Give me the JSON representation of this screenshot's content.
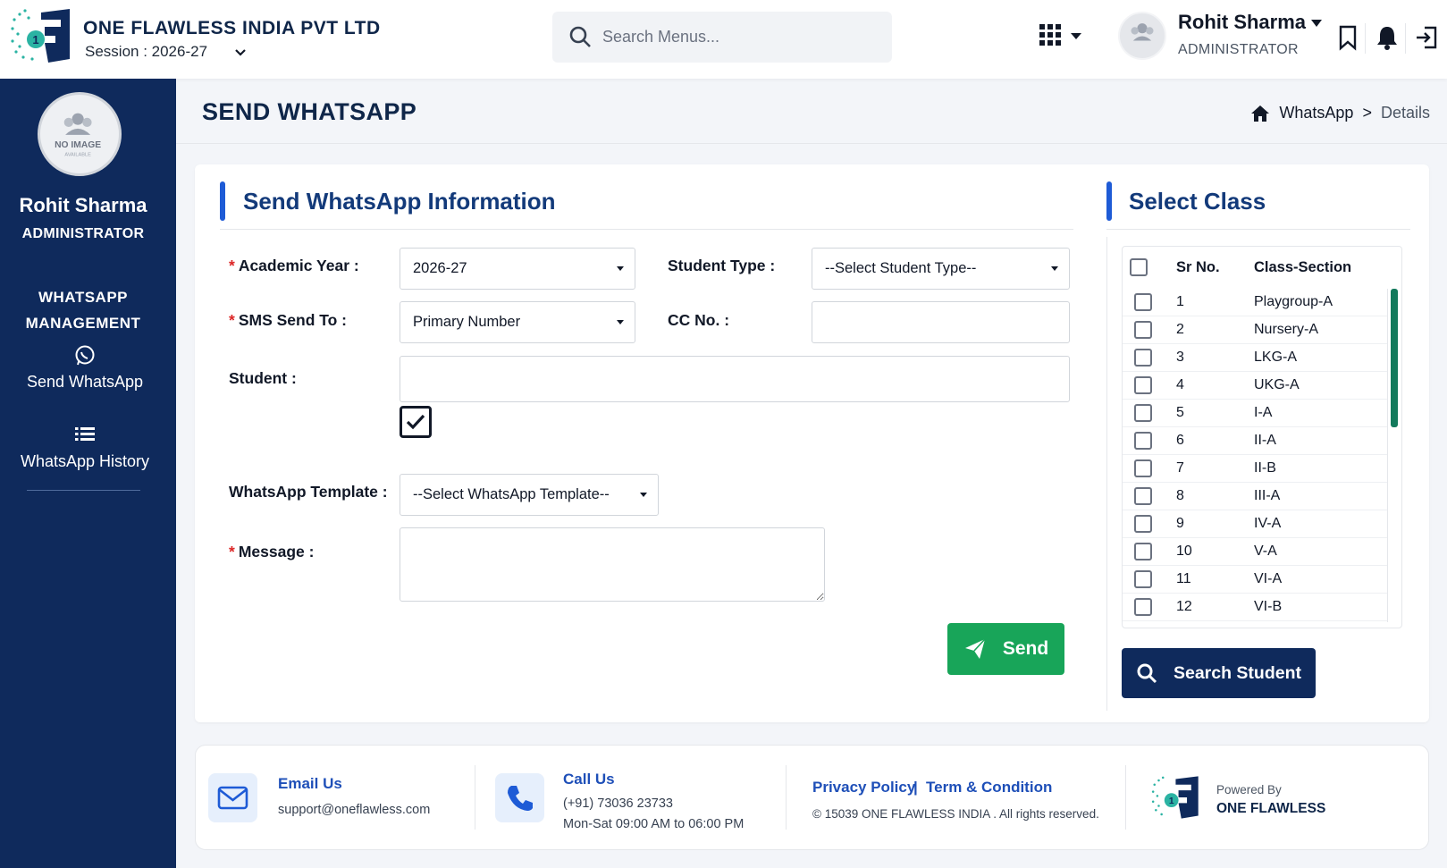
{
  "brand": {
    "company": "ONE FLAWLESS INDIA PVT LTD",
    "session": "Session : 2026-27"
  },
  "header": {
    "search_placeholder": "Search Menus...",
    "user_name": "Rohit Sharma",
    "user_role": "ADMINISTRATOR"
  },
  "sidebar": {
    "avatar_text": "NO IMAGE",
    "avatar_subtext": "AVAILABLE",
    "name": "Rohit Sharma",
    "role": "ADMINISTRATOR",
    "section_line1": "WHATSAPP",
    "section_line2": "MANAGEMENT",
    "items": [
      {
        "label": "Send WhatsApp",
        "icon": "whatsapp-icon"
      },
      {
        "label": "WhatsApp History",
        "icon": "list-icon"
      }
    ]
  },
  "page": {
    "title": "SEND WHATSAPP",
    "breadcrumb": {
      "parent": "WhatsApp",
      "separator": ">",
      "current": "Details"
    }
  },
  "form": {
    "title": "Send WhatsApp Information",
    "academic_year_label": "Academic Year :",
    "academic_year_value": "2026-27",
    "student_type_label": "Student Type :",
    "student_type_value": "--Select Student Type--",
    "sms_send_to_label": "SMS Send To :",
    "sms_send_to_value": "Primary Number",
    "cc_no_label": "CC No. :",
    "cc_no_value": "",
    "student_label": "Student :",
    "student_value": "",
    "student_checkbox_checked": true,
    "template_label": "WhatsApp Template :",
    "template_value": "--Select WhatsApp Template--",
    "message_label": "Message :",
    "message_value": "",
    "required_mark": "*",
    "send_label": "Send"
  },
  "class_panel": {
    "title": "Select Class",
    "col_sr": "Sr No.",
    "col_class": "Class-Section",
    "rows": [
      {
        "sr": "1",
        "cls": "Playgroup-A"
      },
      {
        "sr": "2",
        "cls": "Nursery-A"
      },
      {
        "sr": "3",
        "cls": "LKG-A"
      },
      {
        "sr": "4",
        "cls": "UKG-A"
      },
      {
        "sr": "5",
        "cls": "I-A"
      },
      {
        "sr": "6",
        "cls": "II-A"
      },
      {
        "sr": "7",
        "cls": "II-B"
      },
      {
        "sr": "8",
        "cls": "III-A"
      },
      {
        "sr": "9",
        "cls": "IV-A"
      },
      {
        "sr": "10",
        "cls": "V-A"
      },
      {
        "sr": "11",
        "cls": "VI-A"
      },
      {
        "sr": "12",
        "cls": "VI-B"
      }
    ],
    "search_button": "Search Student"
  },
  "footer": {
    "email_title": "Email Us",
    "email": "support@oneflawless.com",
    "call_title": "Call Us",
    "phone": "(+91) 73036 23733",
    "hours": "Mon-Sat 09:00 AM to 06:00 PM",
    "privacy": "Privacy Policy",
    "link_sep": "|",
    "terms": "Term & Condition",
    "copyright": "© 15039 ONE FLAWLESS INDIA . All rights reserved.",
    "powered_by": "Powered By",
    "powered_name": "ONE FLAWLESS"
  },
  "colors": {
    "sidebar_bg": "#0f2a5c",
    "accent_blue": "#1e5bd6",
    "send_green": "#18a559",
    "required_red": "#dc2626",
    "scroll_thumb": "#137a5c"
  }
}
